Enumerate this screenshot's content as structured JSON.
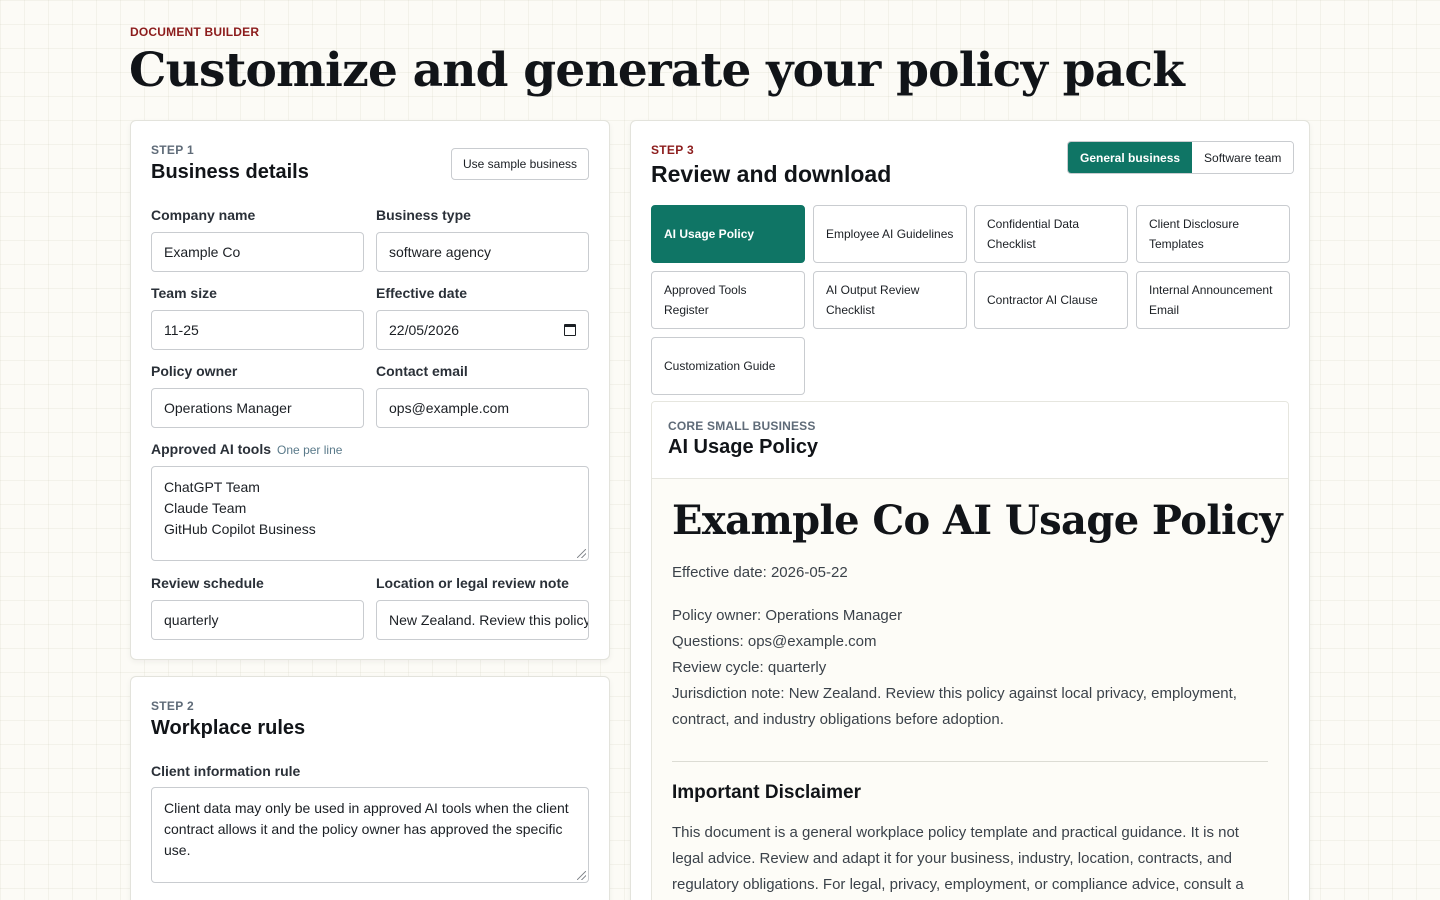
{
  "header": {
    "eyebrow": "DOCUMENT BUILDER",
    "title": "Customize and generate your policy pack"
  },
  "step1": {
    "step": "STEP 1",
    "title": "Business details",
    "sample_button": "Use sample business",
    "company_name": {
      "label": "Company name",
      "value": "Example Co"
    },
    "business_type": {
      "label": "Business type",
      "value": "software agency"
    },
    "team_size": {
      "label": "Team size",
      "value": "11-25"
    },
    "effective_date": {
      "label": "Effective date",
      "value": "22/05/2026"
    },
    "policy_owner": {
      "label": "Policy owner",
      "value": "Operations Manager"
    },
    "contact_email": {
      "label": "Contact email",
      "value": "ops@example.com"
    },
    "approved_tools": {
      "label": "Approved AI tools",
      "hint": "One per line",
      "lines": [
        "ChatGPT Team",
        "Claude Team",
        "GitHub Copilot Business"
      ]
    },
    "review_schedule": {
      "label": "Review schedule",
      "value": "quarterly"
    },
    "location_note": {
      "label": "Location or legal review note",
      "value": "New Zealand. Review this policy against local privacy, employment, contract, and industry obligations before adoption."
    }
  },
  "step2": {
    "step": "STEP 2",
    "title": "Workplace rules",
    "client_rule": {
      "label": "Client information rule",
      "value": "Client data may only be used in approved AI tools when the client contract allows it and the policy owner has approved the specific use."
    }
  },
  "step3": {
    "step": "STEP 3",
    "title": "Review and download",
    "toggle": {
      "general": "General business",
      "software": "Software team",
      "active": "general"
    },
    "documents": [
      {
        "label": "AI Usage Policy",
        "active": true
      },
      {
        "label": "Employee AI Guidelines",
        "active": false
      },
      {
        "label": "Confidential Data Checklist",
        "active": false
      },
      {
        "label": "Client Disclosure Templates",
        "active": false
      },
      {
        "label": "Approved Tools Register",
        "active": false
      },
      {
        "label": "AI Output Review Checklist",
        "active": false
      },
      {
        "label": "Contractor AI Clause",
        "active": false
      },
      {
        "label": "Internal Announcement Email",
        "active": false
      },
      {
        "label": "Customization Guide",
        "active": false
      }
    ],
    "preview": {
      "kicker": "CORE SMALL BUSINESS",
      "name": "AI Usage Policy",
      "heading": "Example Co AI Usage Policy",
      "effective": "Effective date: 2026-05-22",
      "owner": "Policy owner: Operations Manager",
      "questions": "Questions: ops@example.com",
      "review": "Review cycle: quarterly",
      "jurisdiction": "Jurisdiction note: New Zealand. Review this policy against local privacy, employment, contract, and industry obligations before adoption.",
      "disclaimer_title": "Important Disclaimer",
      "disclaimer_text": "This document is a general workplace policy template and practical guidance. It is not legal advice. Review and adapt it for your business, industry, location, contracts, and regulatory obligations. For legal, privacy, employment, or compliance advice, consult a"
    }
  },
  "colors": {
    "accent": "#0f7565",
    "eyebrow": "#8c1c1c",
    "background": "#fcfbf6"
  }
}
